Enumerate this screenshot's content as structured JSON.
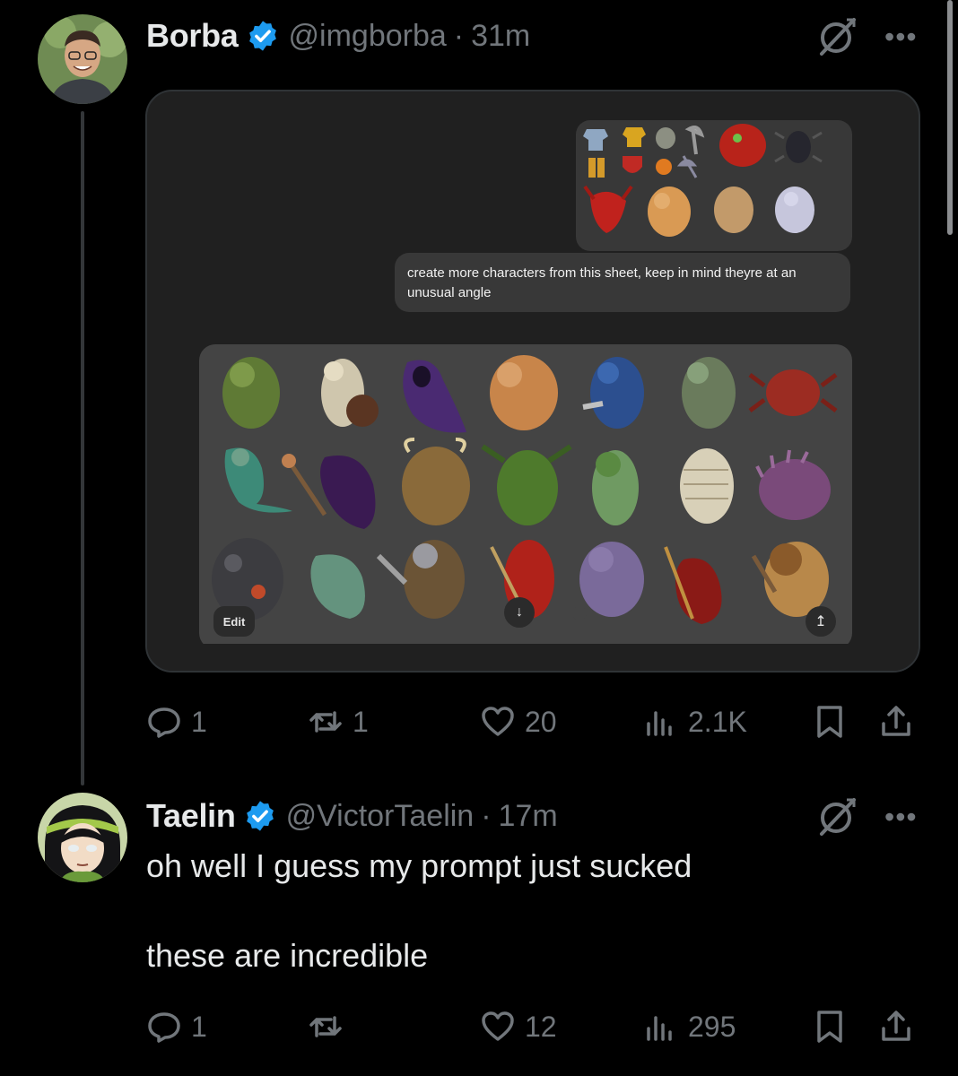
{
  "tweets": [
    {
      "name": "Borba",
      "handle": "@imgborba",
      "separator": "·",
      "time": "31m",
      "media": {
        "prompt": "create more characters from this sheet, keep in mind theyre at an unusual angle",
        "edit_label": "Edit",
        "download_icon": "↓",
        "share_icon": "↥"
      },
      "stats": {
        "replies": "1",
        "reposts": "1",
        "likes": "20",
        "views": "2.1K"
      }
    },
    {
      "name": "Taelin",
      "handle": "@VictorTaelin",
      "separator": "·",
      "time": "17m",
      "text_line1": "oh well I guess my prompt just sucked",
      "text_line2": "these are incredible",
      "stats": {
        "replies": "1",
        "reposts": "",
        "likes": "12",
        "views": "295"
      }
    }
  ],
  "colors": {
    "verified": "#1d9bf0",
    "muted": "#71767b",
    "text": "#e7e9ea"
  }
}
